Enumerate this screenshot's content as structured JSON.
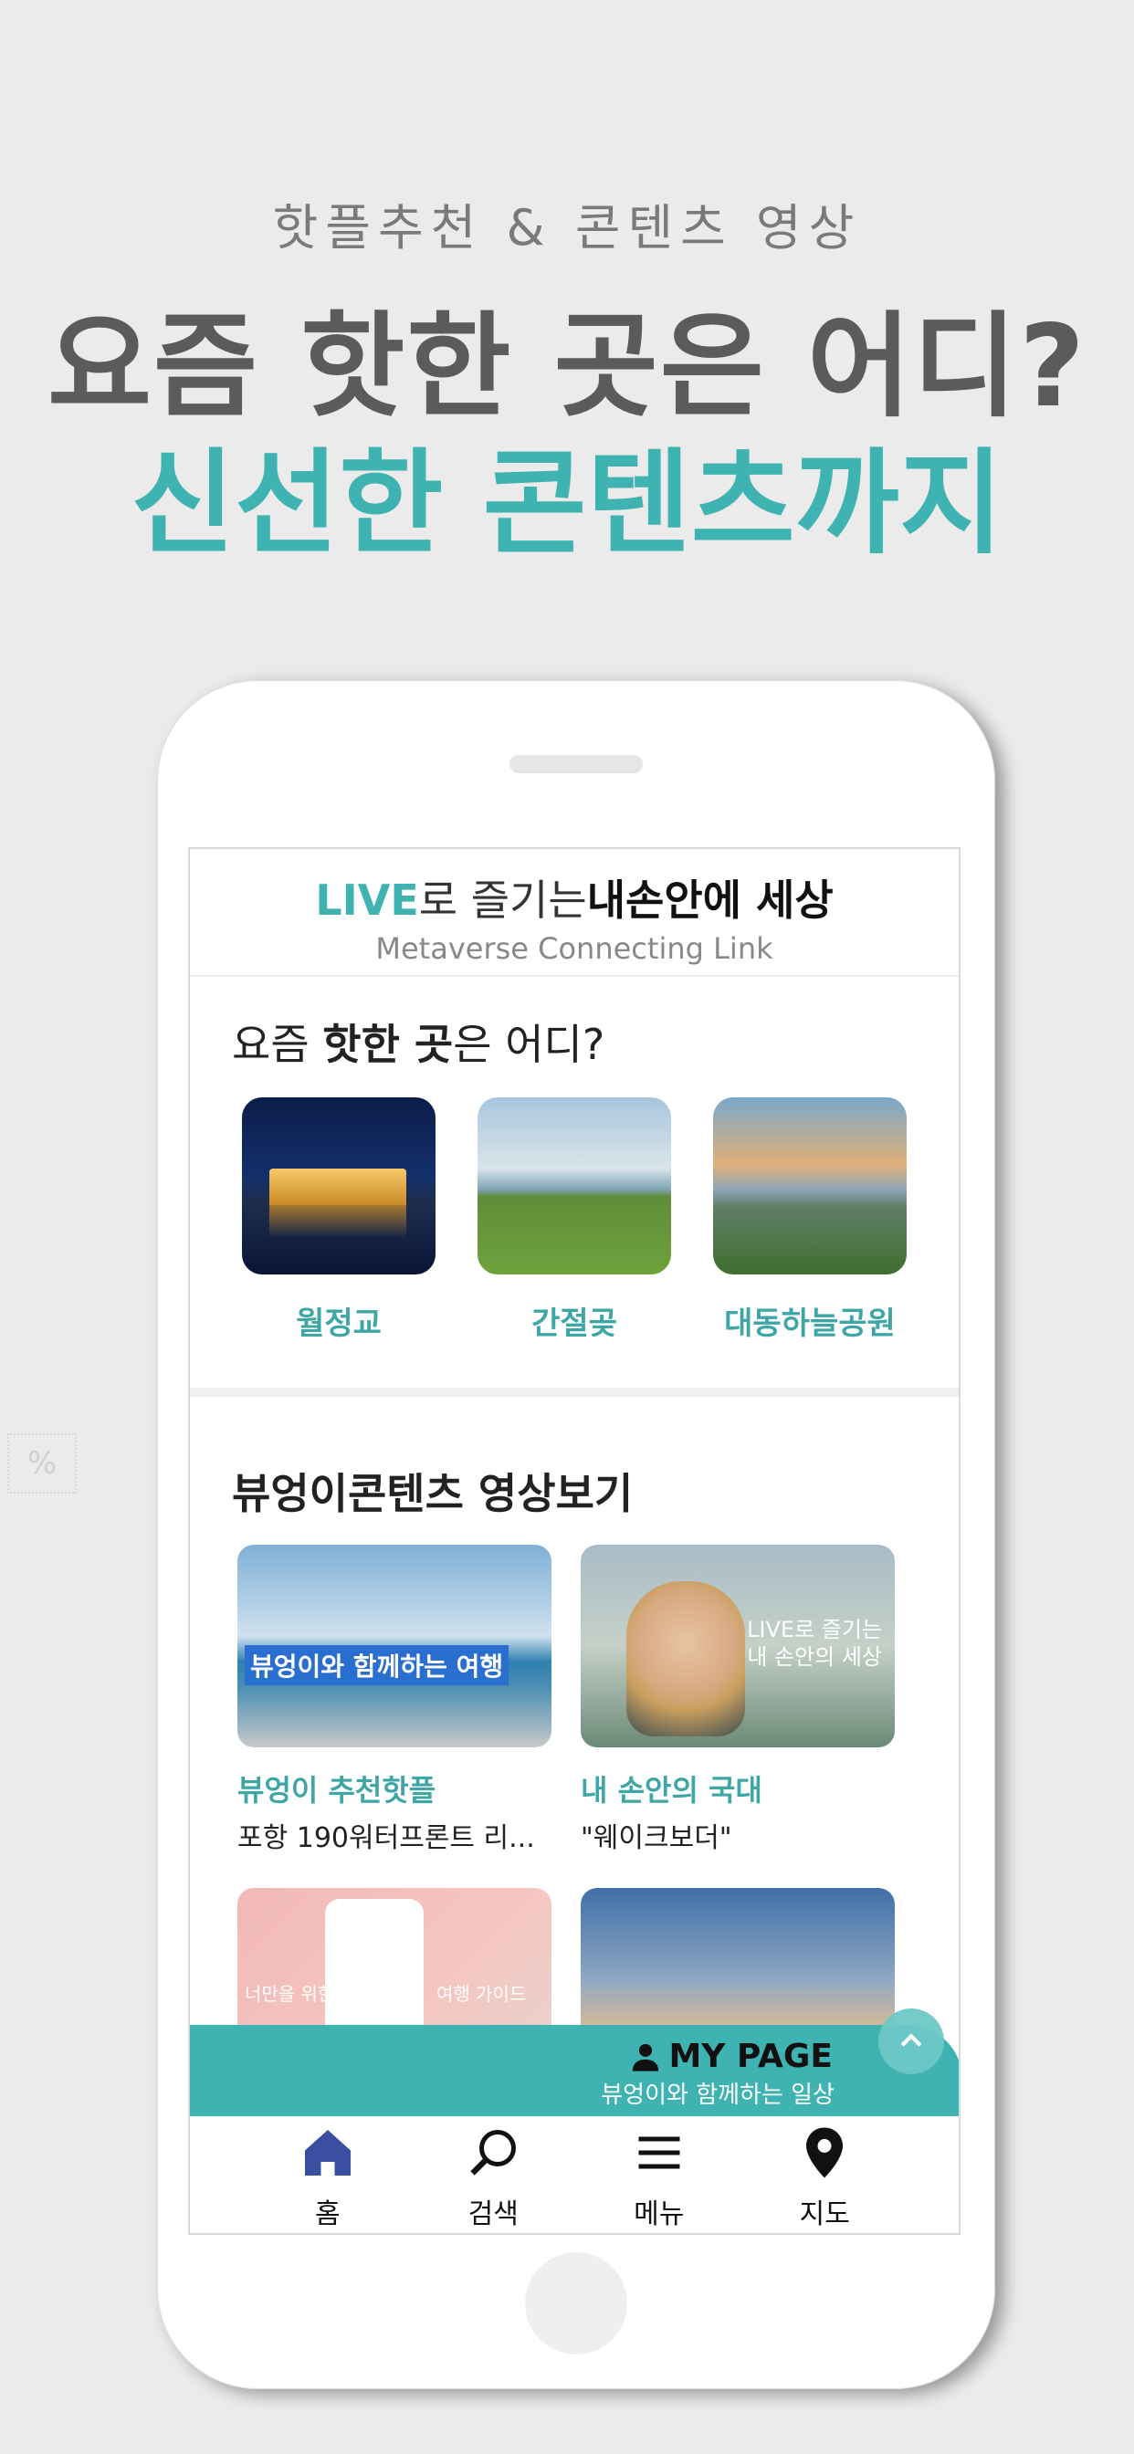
{
  "promo": {
    "subtitle": "핫플추천 & 콘텐츠 영상",
    "title_line1": "요즘 핫한 곳은 어디?",
    "title_line2": "신선한 콘텐츠까지"
  },
  "side_deco": "%",
  "app": {
    "brand_live": "LIVE",
    "brand_mid": "로 즐기는",
    "brand_tail": "내손안에 세상",
    "tagline": "Metaverse Connecting Link"
  },
  "hot": {
    "title_pre": "요즘 ",
    "title_bold": "핫한 곳",
    "title_post": "은 어디?",
    "places": [
      {
        "label": "월정교"
      },
      {
        "label": "간절곶"
      },
      {
        "label": "대동하늘공원"
      }
    ]
  },
  "videos": {
    "title": "뷰엉이콘텐츠 영상보기",
    "items": [
      {
        "title": "뷰엉이 추천핫플",
        "subtitle": "포항 190워터프론트 리...",
        "overlay": "뷰엉이와 함께하는 여행"
      },
      {
        "title": "내 손안의 국대",
        "subtitle": "\"웨이크보더\"",
        "overlay_line1": "LIVE로 즐기는",
        "overlay_line2": "내 손안의 세상"
      },
      {
        "overlay_left": "너만을 위한",
        "overlay_right": "여행 가이드"
      },
      {}
    ]
  },
  "mypage": {
    "label": "MY PAGE",
    "subtitle": "뷰엉이와 함께하는 일상"
  },
  "tabs": [
    {
      "label": "홈",
      "icon": "home-icon"
    },
    {
      "label": "검색",
      "icon": "search-icon"
    },
    {
      "label": "메뉴",
      "icon": "menu-icon"
    },
    {
      "label": "지도",
      "icon": "map-pin-icon"
    }
  ],
  "colors": {
    "accent": "#3fb3b1",
    "title_gray": "#5b5b5b",
    "home_active": "#3a4fa0"
  }
}
